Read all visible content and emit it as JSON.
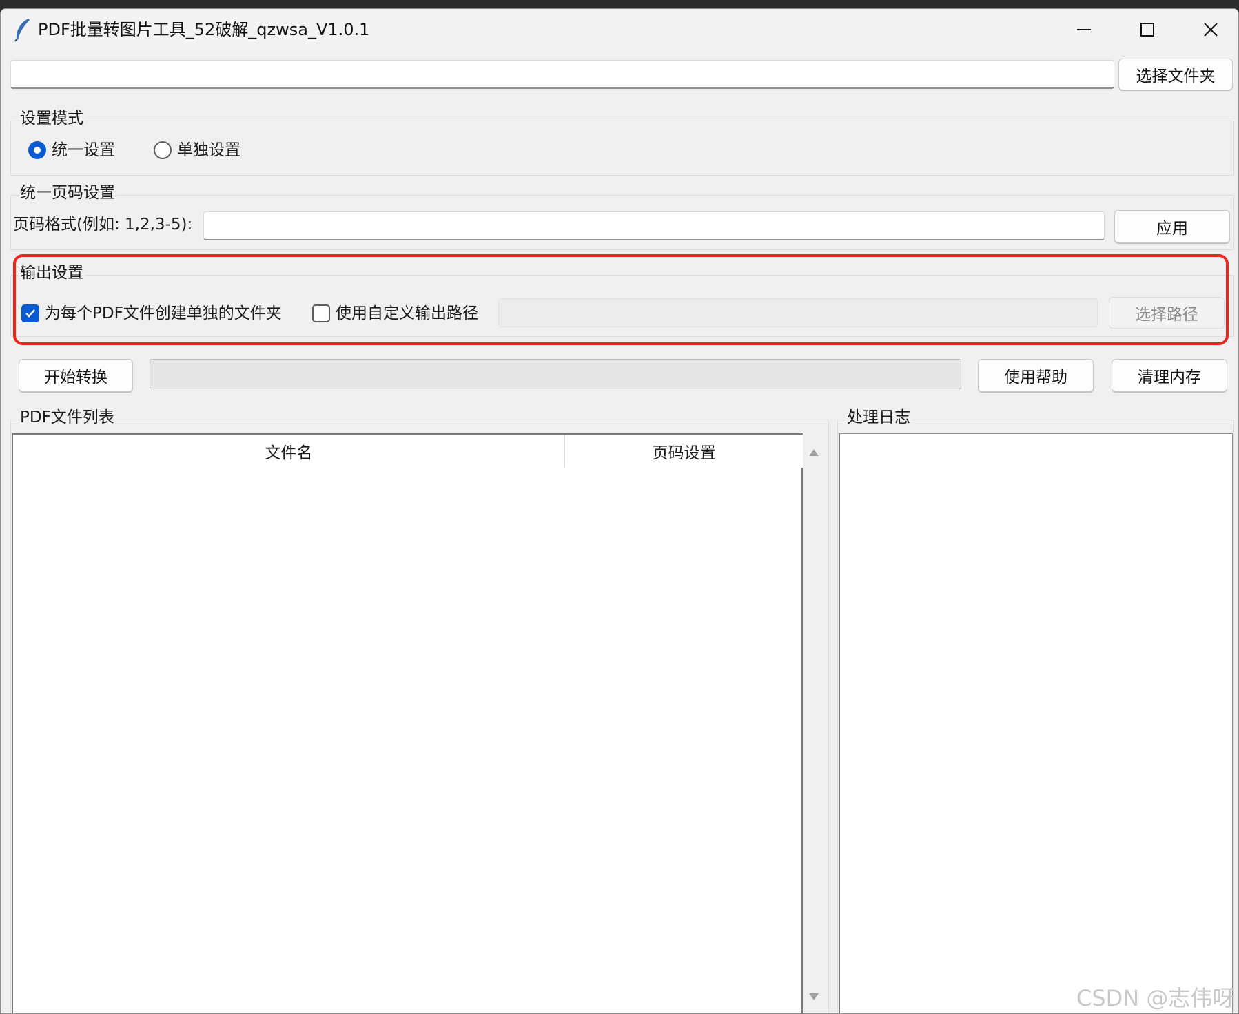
{
  "window": {
    "title": "PDF批量转图片工具_52破解_qzwsa_V1.0.1",
    "icon": "feather-icon"
  },
  "folder": {
    "path_value": "",
    "choose_button": "选择文件夹"
  },
  "mode": {
    "group_title": "设置模式",
    "options": [
      {
        "label": "统一设置",
        "selected": true
      },
      {
        "label": "单独设置",
        "selected": false
      }
    ]
  },
  "pages": {
    "group_title": "统一页码设置",
    "format_label": "页码格式(例如: 1,2,3-5):",
    "format_value": "",
    "apply_button": "应用"
  },
  "output": {
    "group_title": "输出设置",
    "separate_folder": {
      "label": "为每个PDF文件创建单独的文件夹",
      "checked": true
    },
    "custom_path": {
      "label": "使用自定义输出路径",
      "checked": false
    },
    "path_value": "",
    "choose_path_button": "选择路径",
    "highlight_color": "#f0241b"
  },
  "actions": {
    "start_button": "开始转换",
    "progress": 0,
    "help_button": "使用帮助",
    "clear_memory_button": "清理内存"
  },
  "file_list": {
    "group_title": "PDF文件列表",
    "columns": [
      "文件名",
      "页码设置"
    ],
    "rows": []
  },
  "log": {
    "group_title": "处理日志",
    "content": ""
  },
  "watermark": "CSDN @志伟呀",
  "colors": {
    "accent": "#0a5bd3",
    "window_bg": "#f0f0f0",
    "highlight": "#f0241b"
  }
}
